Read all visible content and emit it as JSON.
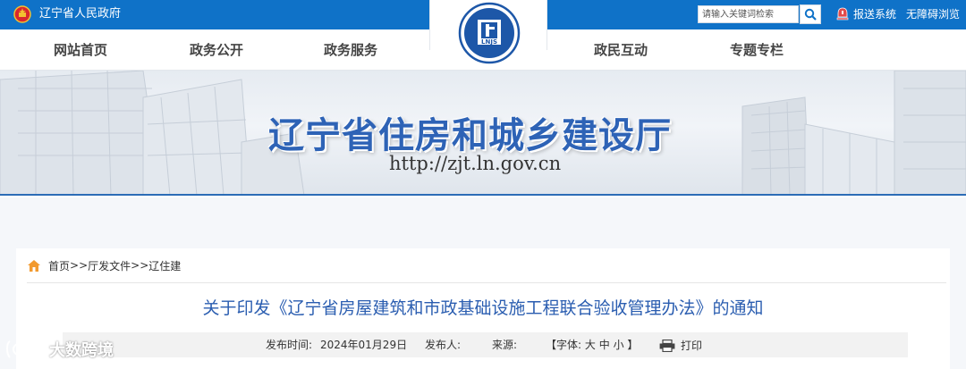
{
  "topbar": {
    "site_name": "辽宁省人民政府",
    "search_placeholder": "请输入关键词检索",
    "report_link": "报送系统",
    "access_link": "无障碍浏览",
    "bg_color": "#0f72c8",
    "icons": [
      "emblem-icon",
      "search-icon",
      "report-icon"
    ]
  },
  "nav": {
    "items": [
      "网站首页",
      "政务公开",
      "政务服务",
      "政民互动",
      "专题专栏"
    ],
    "logo_text": "LNJS"
  },
  "banner": {
    "title": "辽宁省住房和城乡建设厅",
    "url": "http://zjt.ln.gov.cn",
    "title_color": "#2e63b6"
  },
  "breadcrumb": {
    "items": [
      "首页",
      "厅发文件",
      "辽住建"
    ],
    "separator": ">>"
  },
  "article": {
    "title": "关于印发《辽宁省房屋建筑和市政基础设施工程联合验收管理办法》的通知",
    "title_color": "#2a5db0",
    "publish_label": "发布时间:",
    "publish_date": "2024年01月29日",
    "publisher_label": "发布人:",
    "source_label": "来源:",
    "font_label": "【字体:",
    "font_large": "大",
    "font_medium": "中",
    "font_small": "小",
    "font_close": "】",
    "print_label": "打印"
  },
  "watermark": {
    "text": "大数跨境"
  }
}
